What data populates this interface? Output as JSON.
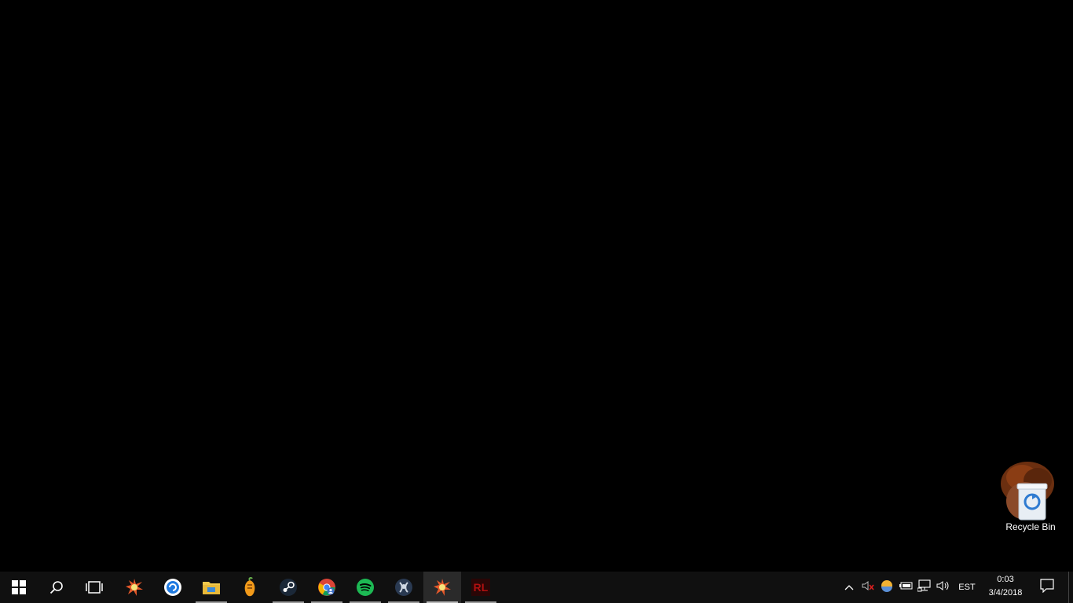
{
  "desktop": {
    "icons": [
      {
        "label": "Recycle Bin",
        "icon": "recycle-bin-icon"
      }
    ]
  },
  "taskbar": {
    "start": {
      "icon": "windows-start-icon"
    },
    "search": {
      "icon": "search-icon"
    },
    "task_view": {
      "icon": "task-view-icon"
    },
    "pinned_apps": [
      {
        "name": "burst-app",
        "icon": "burst-app-icon",
        "running": false
      },
      {
        "name": "blue-circle-app",
        "icon": "blue-circle-app-icon",
        "running": false
      },
      {
        "name": "file-explorer",
        "icon": "file-explorer-icon",
        "running": true
      },
      {
        "name": "fruity-loops",
        "icon": "fl-studio-icon",
        "running": false
      },
      {
        "name": "steam",
        "icon": "steam-icon",
        "running": true
      },
      {
        "name": "chrome",
        "icon": "chrome-icon",
        "running": true
      },
      {
        "name": "spotify",
        "icon": "spotify-icon",
        "running": true
      },
      {
        "name": "teamspeak",
        "icon": "teamspeak-icon",
        "running": true
      },
      {
        "name": "burst-app-active",
        "icon": "burst-app-icon",
        "running": true,
        "active": true
      },
      {
        "name": "rl-app",
        "icon": "rl-app-icon",
        "label": "RL",
        "running": true
      }
    ],
    "tray": {
      "icons": [
        "chevron-up-icon",
        "speaker-muted-icon",
        "sun-app-icon",
        "battery-icon",
        "network-icon",
        "volume-icon"
      ],
      "language": "EST",
      "time": "0:03",
      "date": "3/4/2018",
      "notification_icon": "action-center-icon"
    }
  },
  "colors": {
    "desktop_bg": "#000000",
    "taskbar_bg": "#101010",
    "spotify_green": "#1db954",
    "folder_yellow": "#f2c94c",
    "rl_red": "#b01010"
  }
}
